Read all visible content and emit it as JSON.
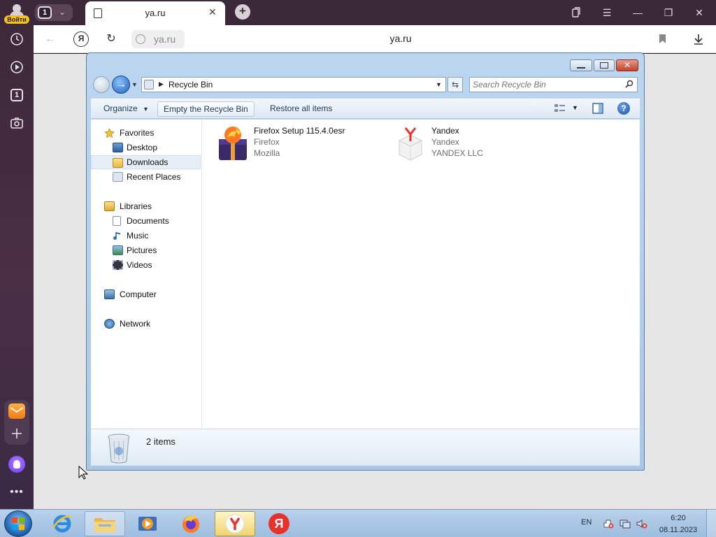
{
  "browser": {
    "login_label": "Войти",
    "tab_count": "1",
    "sidebar_tab_count": "1",
    "active_tab_title": "ya.ru",
    "yandex_button": "Я",
    "url_text": "ya.ru",
    "page_title": "ya.ru"
  },
  "explorer": {
    "breadcrumb": "Recycle Bin",
    "search_placeholder": "Search Recycle Bin",
    "commands": {
      "organize": "Organize",
      "empty": "Empty the Recycle Bin",
      "restore": "Restore all items"
    },
    "nav": {
      "favorites": "Favorites",
      "desktop": "Desktop",
      "downloads": "Downloads",
      "recent": "Recent Places",
      "libraries": "Libraries",
      "documents": "Documents",
      "music": "Music",
      "pictures": "Pictures",
      "videos": "Videos",
      "computer": "Computer",
      "network": "Network"
    },
    "files": [
      {
        "name": "Firefox Setup 115.4.0esr",
        "type": "Firefox",
        "company": "Mozilla"
      },
      {
        "name": "Yandex",
        "type": "Yandex",
        "company": "YANDEX LLC"
      }
    ],
    "details": {
      "count": "2 items"
    }
  },
  "taskbar": {
    "language": "EN",
    "time": "6:20",
    "date": "08.11.2023",
    "yandex_letter": "Я"
  },
  "colors": {
    "sidebar": "#3b2838",
    "login_badge": "#f5c022",
    "yandex_red": "#e8312b",
    "selection": "#e6eef7"
  }
}
